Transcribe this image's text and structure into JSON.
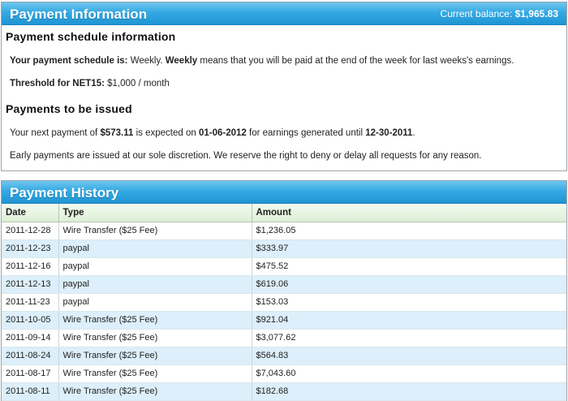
{
  "payment_info": {
    "title": "Payment Information",
    "balance_label": "Current balance:",
    "balance_value": "$1,965.83",
    "schedule_heading": "Payment schedule information",
    "schedule_label": "Your payment schedule is:",
    "schedule_value": "Weekly.",
    "schedule_term": "Weekly",
    "schedule_desc": "means that you will be paid at the end of the week for last weeks's earnings.",
    "threshold_label": "Threshold for NET15:",
    "threshold_value": "$1,000 / month",
    "issued_heading": "Payments to be issued",
    "next_payment_prefix": "Your next payment of",
    "next_payment_amount": "$573.11",
    "next_payment_mid": "is expected on",
    "next_payment_date": "01-06-2012",
    "next_payment_mid2": "for earnings generated until",
    "next_payment_until": "12-30-2011",
    "next_payment_suffix": ".",
    "early_note": "Early payments are issued at our sole discretion. We reserve the right to deny or delay all requests for any reason."
  },
  "history": {
    "title": "Payment History",
    "columns": [
      "Date",
      "Type",
      "Amount"
    ],
    "rows": [
      [
        "2011-12-28",
        "Wire Transfer ($25 Fee)",
        "$1,236.05"
      ],
      [
        "2011-12-23",
        "paypal",
        "$333.97"
      ],
      [
        "2011-12-16",
        "paypal",
        "$475.52"
      ],
      [
        "2011-12-13",
        "paypal",
        "$619.06"
      ],
      [
        "2011-11-23",
        "paypal",
        "$153.03"
      ],
      [
        "2011-10-05",
        "Wire Transfer ($25 Fee)",
        "$921.04"
      ],
      [
        "2011-09-14",
        "Wire Transfer ($25 Fee)",
        "$3,077.62"
      ],
      [
        "2011-08-24",
        "Wire Transfer ($25 Fee)",
        "$564.83"
      ],
      [
        "2011-08-17",
        "Wire Transfer ($25 Fee)",
        "$7,043.60"
      ],
      [
        "2011-08-11",
        "Wire Transfer ($25 Fee)",
        "$182.68"
      ]
    ]
  },
  "colors": {
    "header_blue": "#2aa0dc",
    "row_alt": "#dceffa",
    "table_head": "#dcefd5"
  }
}
